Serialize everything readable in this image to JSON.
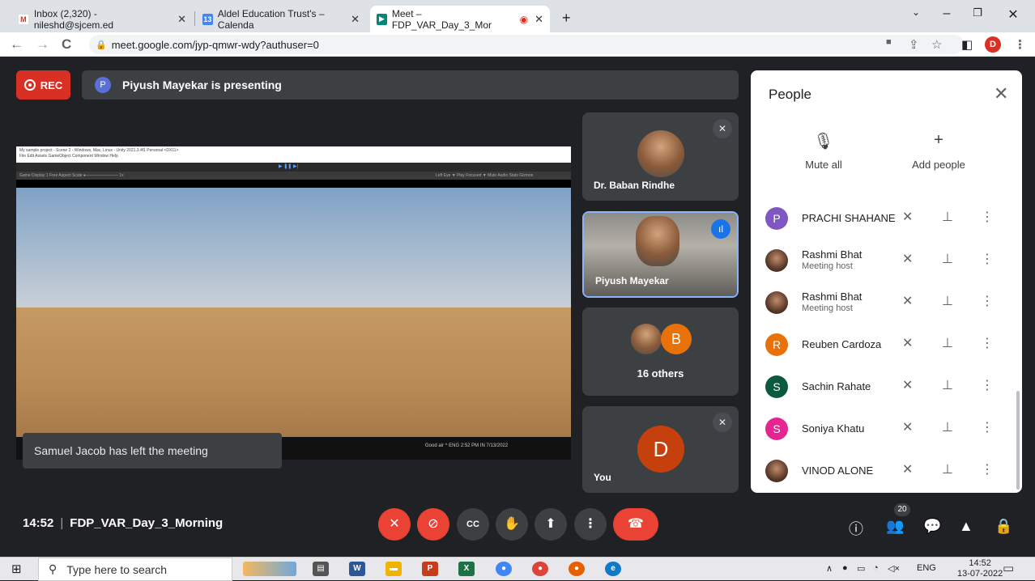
{
  "browser": {
    "tabs": [
      {
        "title": "Inbox (2,320) - nileshd@sjcem.ed",
        "icon": "gmail-icon"
      },
      {
        "title": "Aldel Education Trust's – Calenda",
        "icon": "calendar-icon"
      },
      {
        "title": "Meet – FDP_VAR_Day_3_Mor",
        "icon": "meet-icon"
      }
    ],
    "new_tab": "+",
    "url": "meet.google.com/jyp-qmwr-wdy?authuser=0",
    "profile_initial": "D"
  },
  "meet": {
    "rec_label": "REC",
    "presenter_initial": "P",
    "presenting_text": "Piyush Mayekar is presenting",
    "screen": {
      "window_title": "My sample project - Scene 2 - Windows, Mac, Linux - Unity 2021.3.4f1 Personal <DX11>",
      "menu": "File  Edit  Assets  GameObject  Component  Window  Help",
      "game_bar": "Game    Display 1    Free Aspect    Scale ●———————— 1x",
      "game_bar_right": "Left Eye  ▼ Play Focused  ▼ Mute Audio  Stats  Gizmos",
      "taskbar_right": "Good air  ^  ENG  2:52 PM  IN  7/13/2022"
    },
    "toast": "Samuel Jacob has left the meeting",
    "tiles": [
      {
        "name": "Dr. Baban Rindhe"
      },
      {
        "name": "Piyush Mayekar"
      },
      {
        "name": "16 others",
        "initial": "B"
      },
      {
        "name": "You",
        "initial": "D"
      }
    ],
    "meeting_time": "14:52",
    "meeting_name": "FDP_VAR_Day_3_Morning",
    "participant_count": "20"
  },
  "people_panel": {
    "title": "People",
    "mute_all": "Mute all",
    "add_people": "Add people",
    "participants": [
      {
        "name": "PRACHI SHAHANE",
        "initial": "P",
        "color": "#7e57c2",
        "sub": ""
      },
      {
        "name": "Rashmi Bhat",
        "sub": "Meeting host",
        "photo": true
      },
      {
        "name": "Rashmi Bhat",
        "sub": "Meeting host",
        "photo": true
      },
      {
        "name": "Reuben Cardoza",
        "initial": "R",
        "color": "#e8710a",
        "sub": ""
      },
      {
        "name": "Sachin Rahate",
        "initial": "S",
        "color": "#0b5a3f",
        "sub": ""
      },
      {
        "name": "Soniya Khatu",
        "initial": "S",
        "color": "#e52592",
        "sub": ""
      },
      {
        "name": "VINOD ALONE",
        "photo": true,
        "sub": ""
      }
    ]
  },
  "taskbar": {
    "search_placeholder": "Type here to search",
    "language": "ENG",
    "time": "14:52",
    "date": "13-07-2022"
  },
  "colors": {
    "accent_red": "#ea4335",
    "meet_bg": "#202124",
    "tile_bg": "#3c4043",
    "blue": "#1a73e8"
  }
}
